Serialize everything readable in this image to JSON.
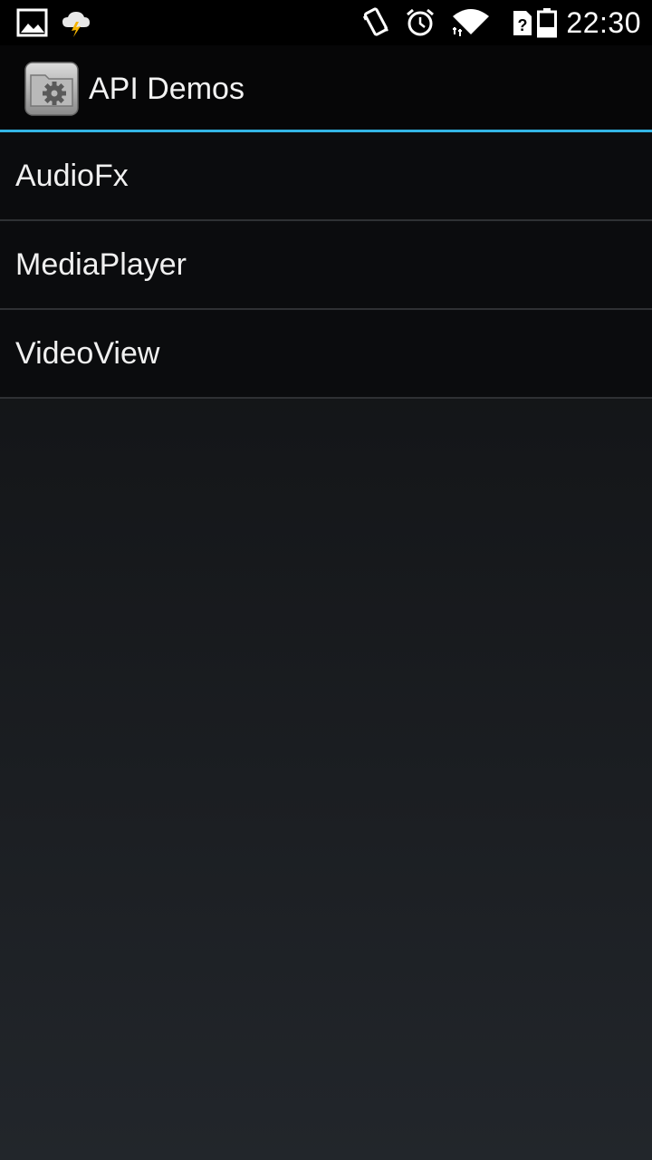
{
  "status_bar": {
    "time": "22:30",
    "icons": [
      "image-notification-icon",
      "weather-storm-icon",
      "vibrate-icon",
      "alarm-icon",
      "wifi-icon",
      "no-sim-icon",
      "battery-icon"
    ]
  },
  "action_bar": {
    "title": "API Demos",
    "icon": "settings-folder-icon"
  },
  "list": {
    "items": [
      {
        "label": "AudioFx"
      },
      {
        "label": "MediaPlayer"
      },
      {
        "label": "VideoView"
      }
    ]
  },
  "colors": {
    "accent": "#33b5e5",
    "divider": "#2f3134",
    "text": "#f0f0f0"
  }
}
